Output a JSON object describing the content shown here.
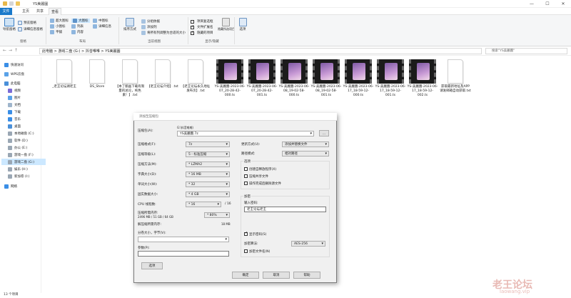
{
  "window": {
    "title": "YS美麗圖",
    "min": "—",
    "max": "☐",
    "close": "✕"
  },
  "tabs": [
    "文件",
    "主页",
    "共享",
    "查看"
  ],
  "ribbon": {
    "pane": {
      "nav_pane": "导航窗格",
      "preview_pane": "预览窗格",
      "details_pane": "详细信息窗格",
      "label": "窗格"
    },
    "layout": {
      "items": [
        "超大图标",
        "大图标",
        "中图标",
        "小图标",
        "列表",
        "详细信息",
        "平铺",
        "内容"
      ],
      "label": "布局"
    },
    "current_view": {
      "sort": "排序方式",
      "group": "分组依据",
      "add_cols": "添加列",
      "fit_cols": "将所有列调整为合适的大小",
      "label": "当前视图"
    },
    "show_hide": {
      "item_checkbox": "项目复选框",
      "ext": "文件扩展名",
      "hidden": "隐藏的项目",
      "hide_selected": "隐藏所选项目",
      "label": "显示/隐藏"
    },
    "options": "选项"
  },
  "address": {
    "path": [
      "此电脑",
      "游戏二盘 (G:)",
      "抖音唯唯",
      "YS美麗圖"
    ],
    "search_placeholder": "搜索\"YS美麗圖\""
  },
  "nav": [
    "快速访问",
    "WPS云盘",
    "此电脑",
    "视频",
    "图片",
    "文档",
    "下载",
    "音乐",
    "桌面",
    "本地磁盘 (C:)",
    "软件 (D:)",
    "办公 (E:)",
    "游戏一盘 (F:)",
    "游戏二盘 (G:)",
    "娱乐 (H:)",
    "新加卷 (I:)",
    "网络"
  ],
  "files": [
    {
      "name": "_老王论坛湖老王",
      "kind": "doc"
    },
    {
      "name": "DS_Store",
      "kind": "doc"
    },
    {
      "name": "【本了鹅画下载有限量的总论，纯色素！】.txt",
      "kind": "doc"
    },
    {
      "name": "【老王论坛介绍】.txt",
      "kind": "doc"
    },
    {
      "name": "【老王论坛永久地址发布页】.txt",
      "kind": "doc"
    },
    {
      "name": "YS-美麗圖-2023-06-07_20-28-42-000.ts",
      "kind": "video"
    },
    {
      "name": "YS-美麗圖-2023-06-07_20-28-42-001.ts",
      "kind": "video"
    },
    {
      "name": "YS-美麗圖-2023-06-08_19-02-58-000.ts",
      "kind": "video"
    },
    {
      "name": "YS-美麗圖-2023-06-08_19-02-58-001.ts",
      "kind": "video"
    },
    {
      "name": "YS-美麗圖-2023-06-17_18-59-12-000.ts",
      "kind": "video"
    },
    {
      "name": "YS-美麗圖-2023-06-17_18-59-12-001.ts",
      "kind": "video"
    },
    {
      "name": "YS-美麗圖-2023-06-17_18-59-12-002.ts",
      "kind": "video"
    },
    {
      "name": "获取最新地址及APP请发邮箱自动获取.txt",
      "kind": "doc"
    }
  ],
  "status": "13 个项目",
  "dialog": {
    "title": "添加至压缩包",
    "archive_label": "压缩包(A):",
    "archive_path": "G:\\抖音唯唯\\",
    "archive_name": "YS美麗圖.7z",
    "browse": "...",
    "format_label": "压缩格式(F):",
    "format": "7z",
    "level_label": "压缩等级(L):",
    "level": "5 - 标准压缩",
    "method_label": "压缩方法(M):",
    "method": "* LZMA2",
    "dict_label": "字典大小(D):",
    "dict": "* 16 MB",
    "word_label": "单词大小(W):",
    "word": "* 32",
    "solid_label": "固实数据大小:",
    "solid": "* 4 GB",
    "cpu_label": "CPU 线程数:",
    "cpu": "* 16",
    "cpu_max": "/ 16",
    "mem_label": "压缩所需内存:",
    "mem_value": "2496 MB / 51 GB / 64 GB",
    "mem_pct": "* 80%",
    "decomp_label": "解压缩所需内存:",
    "decomp_value": "18 MB",
    "split_label": "分卷大小，字节(V):",
    "params_label": "参数(P):",
    "options_btn": "选项",
    "update_label": "更新方式(U):",
    "update": "添加并替换文件",
    "pathmode_label": "路径模式:",
    "pathmode": "相对路径",
    "group_options": "选项",
    "opt_sfx": "创建自释放程序(X)",
    "opt_shared": "压缩共享文件",
    "opt_delete": "操作完成后删除源文件",
    "group_encrypt": "加密",
    "pwd_label": "输入密码:",
    "pwd_value": "老王论坛老王",
    "show_pwd": "显示密码(S)",
    "enc_method_label": "加密算法:",
    "enc_method": "AES-256",
    "enc_names": "加密文件名(N)",
    "ok": "确定",
    "cancel": "取消",
    "help": "帮助"
  },
  "watermark": {
    "main": "老王论坛",
    "sub": "laowang.vip"
  }
}
